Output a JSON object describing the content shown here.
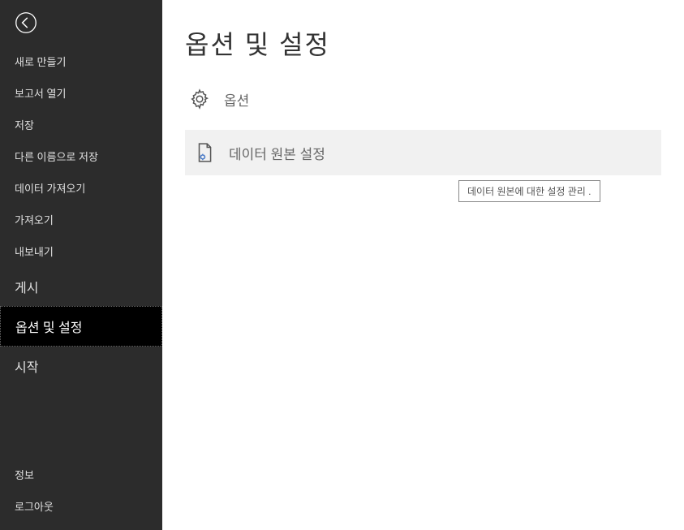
{
  "sidebar": {
    "items": [
      {
        "label": "새로 만들기"
      },
      {
        "label": "보고서 열기"
      },
      {
        "label": "저장"
      },
      {
        "label": "다른 이름으로 저장"
      },
      {
        "label": "데이터 가져오기"
      },
      {
        "label": "가져오기"
      },
      {
        "label": "내보내기"
      },
      {
        "label": "게시"
      },
      {
        "label": "옵션 및 설정"
      },
      {
        "label": "시작"
      }
    ],
    "bottom": [
      {
        "label": "정보"
      },
      {
        "label": "로그아웃"
      }
    ]
  },
  "main": {
    "title": "옵션 및 설정",
    "options_label": "옵션",
    "data_source_label": "데이터 원본 설정",
    "tooltip": "데이터 원본에 대한 설정 관리 ."
  }
}
